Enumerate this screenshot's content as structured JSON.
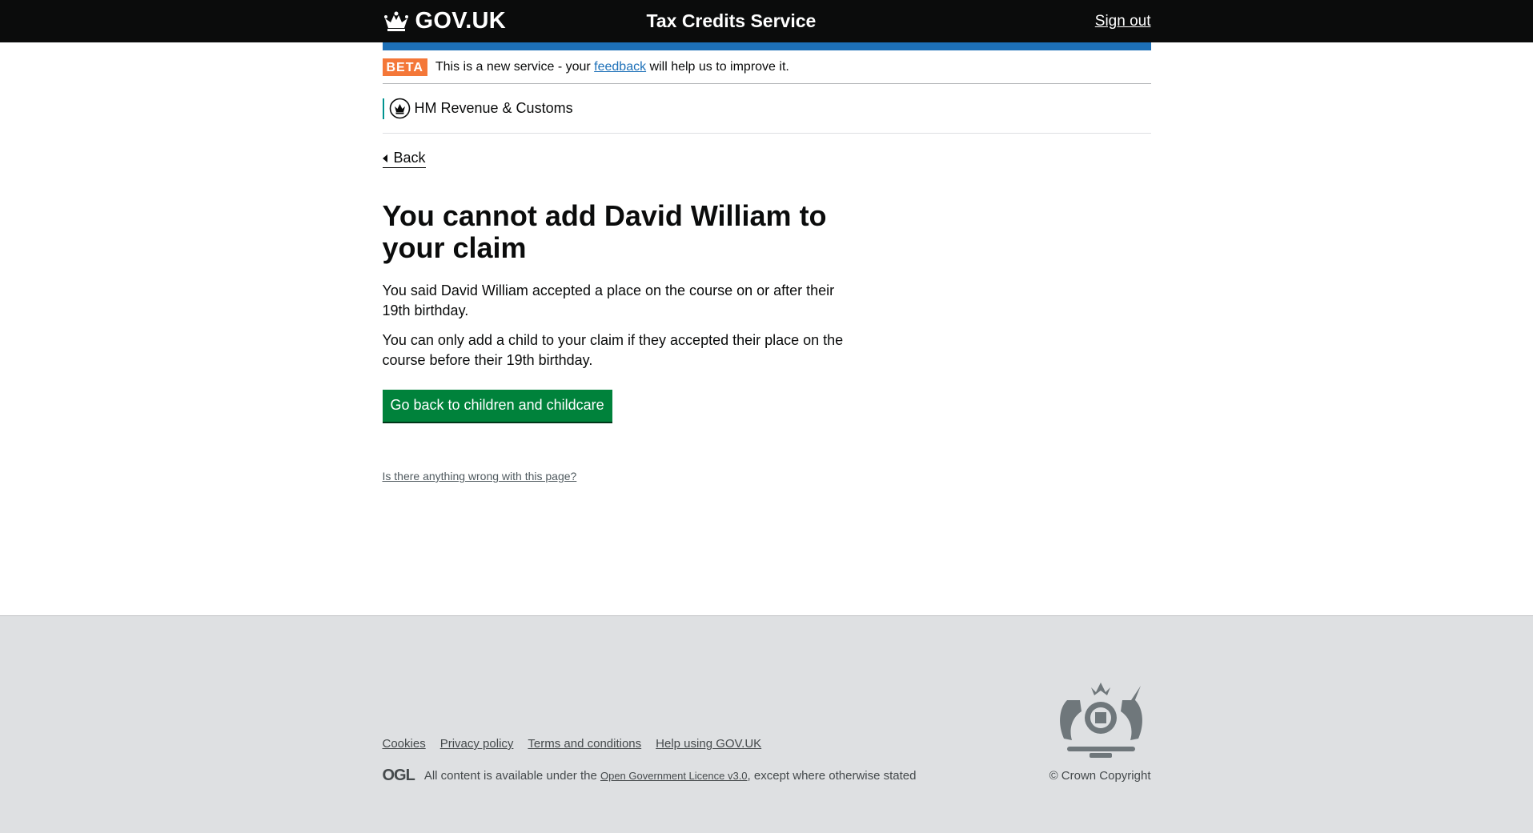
{
  "header": {
    "logo_text": "GOV.UK",
    "service_name": "Tax Credits Service",
    "sign_out": "Sign out"
  },
  "phase": {
    "tag": "BETA",
    "text_before": "This is a new service - your ",
    "link": "feedback",
    "text_after": " will help us to improve it."
  },
  "organisation": {
    "name": "HM Revenue & Customs"
  },
  "back_link": "Back",
  "main": {
    "heading": "You cannot add David William to your claim",
    "paragraph1": "You said David William accepted a place on the course on or after their 19th birthday.",
    "paragraph2": "You can only add a child to your claim if they accepted their place on the course before their 19th birthday.",
    "button": "Go back to children and childcare",
    "report_link": "Is there anything wrong with this page?"
  },
  "footer": {
    "links": [
      "Cookies",
      "Privacy policy",
      "Terms and conditions",
      "Help using GOV.UK"
    ],
    "ogl": "OGL",
    "licence_before": "All content is available under the ",
    "licence_link": "Open Government Licence v3.0",
    "licence_after": ", except where otherwise stated",
    "copyright": "© Crown Copyright"
  },
  "colors": {
    "header_bg": "#0b0c0c",
    "blue_bar": "#1d70b8",
    "beta_tag": "#f47738",
    "button_green": "#00823b",
    "footer_bg": "#dee0e2"
  }
}
